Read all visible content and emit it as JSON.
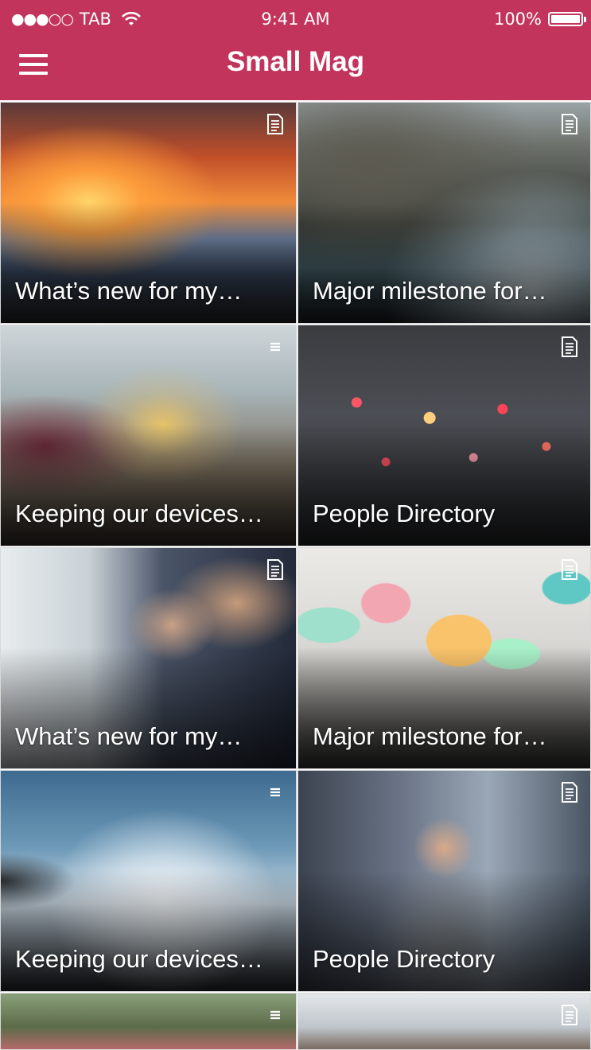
{
  "status_bar": {
    "signal": "●●●○○",
    "carrier": "TAB",
    "time": "9:41 AM",
    "battery": "100%"
  },
  "nav": {
    "title": "Small Mag",
    "menu_icon": "hamburger-menu-icon"
  },
  "colors": {
    "brand": "#c3345c"
  },
  "tiles": [
    {
      "caption": "What’s new for my…",
      "icon": "document-icon"
    },
    {
      "caption": "Major milestone for…",
      "icon": "document-icon"
    },
    {
      "caption": "Keeping our devices…",
      "icon": "list-icon"
    },
    {
      "caption": "People Directory",
      "icon": "document-icon"
    },
    {
      "caption": "What’s new for my…",
      "icon": "document-icon"
    },
    {
      "caption": "Major milestone for…",
      "icon": "document-icon"
    },
    {
      "caption": "Keeping our devices…",
      "icon": "list-icon"
    },
    {
      "caption": "People Directory",
      "icon": "document-icon"
    },
    {
      "caption": "",
      "icon": "list-icon"
    },
    {
      "caption": "",
      "icon": "document-icon"
    }
  ]
}
